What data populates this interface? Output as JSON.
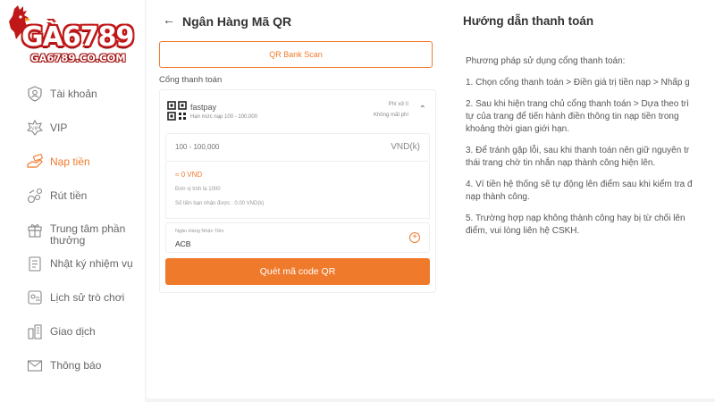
{
  "brand": {
    "name": "GÀ6789",
    "domain": "GA6789.CO.COM",
    "primary_red": "#c01818"
  },
  "accent_color": "#f07a2c",
  "sidebar": {
    "items": [
      {
        "label": "Tài khoản",
        "icon": "user-icon"
      },
      {
        "label": "VIP",
        "icon": "vip-badge-icon"
      },
      {
        "label": "Nạp tiền",
        "icon": "deposit-money-icon",
        "active": true
      },
      {
        "label": "Rút tiền",
        "icon": "withdraw-icon"
      },
      {
        "label": "Trung tâm phần",
        "label2": "thưởng",
        "icon": "gift-icon"
      },
      {
        "label": "Nhật ký nhiệm vụ",
        "icon": "task-log-icon"
      },
      {
        "label": "Lịch sử trò chơi",
        "icon": "game-history-icon"
      },
      {
        "label": "Giao dịch",
        "icon": "transaction-icon"
      },
      {
        "label": "Thông báo",
        "icon": "mail-icon"
      }
    ]
  },
  "header": {
    "title": "Ngân Hàng Mã QR"
  },
  "qr_scan_button": "QR Bank Scan",
  "gateway": {
    "section_label": "Cổng thanh toán",
    "name": "fastpay",
    "limit": "Hạn mức nạp 100 - 100,000",
    "fee_label": "Phí xử lí",
    "fee_value": "Không mất phí",
    "amount_placeholder": "100 - 100,000",
    "amount_unit": "VND(k)",
    "converted": "≈ 0 VND",
    "unit_note": "Đơn vị tính là 1000",
    "receive_note": "Số tiền bạn nhận được : 0.00 VND(k)",
    "bank_label": "Ngân Hàng Nhận Tiền",
    "bank_value": "ACB",
    "submit_button": "Quét mã code QR"
  },
  "guide": {
    "title": "Hướng dẫn thanh toán",
    "intro": "Phương pháp sử dụng cổng thanh toán:",
    "steps": [
      {
        "line1": "1. Chọn cổng thanh toán > Điền giá trị tiền nạp > Nhấp g"
      },
      {
        "line1": "2. Sau khi hiện trang chủ cổng thanh toán > Dựa theo trì",
        "line2": "tự của trang để tiến hành điền thông tin nạp tiền trong",
        "line3": "khoảng thời gian giới hạn."
      },
      {
        "line1": "3. Để tránh gặp lỗi, sau khi thanh toán nên giữ nguyên tr",
        "line2": "thái trang chờ tin nhắn nạp thành công hiện lên."
      },
      {
        "line1": "4. Ví tiền hệ thống sẽ tự động lên điểm sau khi kiểm tra đ",
        "line2": "nạp thành công."
      },
      {
        "line1": "5. Trường hợp nạp không thành công hay bị từ chối lên",
        "line2": "điểm, vui lòng liên hệ CSKH."
      }
    ]
  }
}
